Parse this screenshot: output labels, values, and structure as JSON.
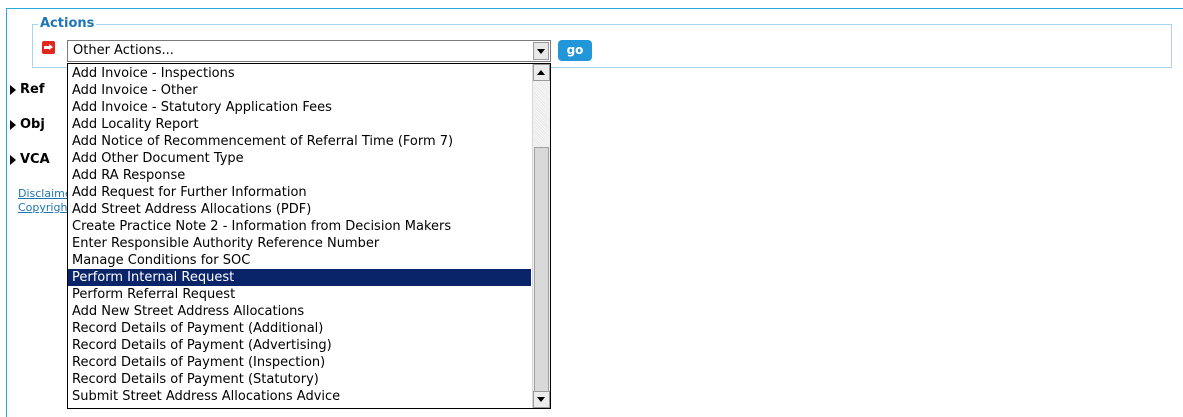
{
  "actions": {
    "legend": "Actions",
    "select_value": "Other Actions...",
    "go_label": "go"
  },
  "sidebar": {
    "items": [
      {
        "label": "Ref"
      },
      {
        "label": "Obj"
      },
      {
        "label": "VCA"
      }
    ],
    "links": [
      {
        "label": "Disclaimer"
      },
      {
        "label": "Copyright"
      }
    ]
  },
  "dropdown": {
    "selected": "Perform Internal Request",
    "options": [
      "Add Invoice - Inspections",
      "Add Invoice - Other",
      "Add Invoice - Statutory Application Fees",
      "Add Locality Report",
      "Add Notice of Recommencement of Referral Time (Form 7)",
      "Add Other Document Type",
      "Add RA Response",
      "Add Request for Further Information",
      "Add Street Address Allocations (PDF)",
      "Create Practice Note 2 - Information from Decision Makers",
      "Enter Responsible Authority Reference Number",
      "Manage Conditions for SOC",
      "Perform Internal Request",
      "Perform Referral Request",
      "Add New Street Address Allocations",
      "Record Details of Payment (Additional)",
      "Record Details of Payment (Advertising)",
      "Record Details of Payment (Inspection)",
      "Record Details of Payment (Statutory)",
      "Submit Street Address Allocations Advice"
    ]
  },
  "colors": {
    "accent": "#29a9e0",
    "legend_text": "#1e76b5",
    "go_button": "#2196d8",
    "selected_option": "#0a246a",
    "icon_red": "#e2261c"
  }
}
